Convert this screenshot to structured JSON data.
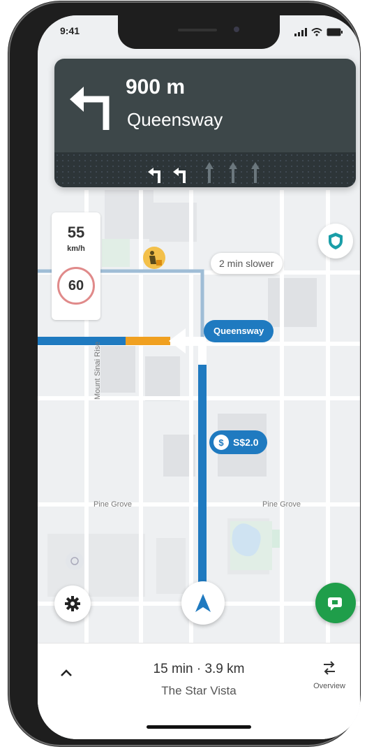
{
  "status_bar": {
    "time": "9:41"
  },
  "instruction": {
    "distance": "900 m",
    "street": "Queensway"
  },
  "speed": {
    "current": "55",
    "unit": "km/h",
    "limit": "60"
  },
  "map": {
    "traffic_bubble": "2 min slower",
    "street_pill": "Queensway",
    "toll_label": "S$2.0",
    "road_labels": [
      "Pine Grove",
      "Pine Grove",
      "Mount Sinai Rise"
    ]
  },
  "trip": {
    "eta": "15 min · 3.9 km",
    "destination": "The Star Vista",
    "overview_label": "Overview"
  },
  "icons": {
    "turn": "turn-left-icon",
    "shield": "shield-icon",
    "settings": "gear-icon",
    "recenter": "navigation-arrow-icon",
    "report": "report-icon",
    "expand": "chevron-up-icon",
    "overview": "route-overview-icon",
    "hazard": "roadworks-icon"
  },
  "colors": {
    "route": "#1f7ac0",
    "traffic": "#f0a020",
    "banner": "#3d4749",
    "report_button": "#1f9e4a"
  }
}
